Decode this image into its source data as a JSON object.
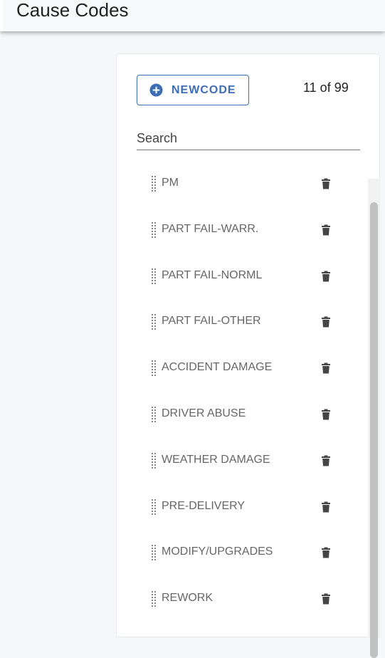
{
  "header": {
    "title": "Cause Codes"
  },
  "toolbar": {
    "new_code_label": "NEWCODE",
    "new_code_icon": "plus-circle-icon",
    "count_text": "11 of 99"
  },
  "search": {
    "placeholder": "Search",
    "value": ""
  },
  "colors": {
    "accent": "#3d6eb5",
    "item_text": "#666666",
    "icon": "#444444",
    "scroll_thumb": "#c1c1c1"
  },
  "list": {
    "items": [
      {
        "label": "PM"
      },
      {
        "label": "PART FAIL-WARR."
      },
      {
        "label": "PART FAIL-NORML"
      },
      {
        "label": "PART FAIL-OTHER"
      },
      {
        "label": "ACCIDENT DAMAGE"
      },
      {
        "label": "DRIVER ABUSE"
      },
      {
        "label": "WEATHER DAMAGE"
      },
      {
        "label": "PRE-DELIVERY"
      },
      {
        "label": "MODIFY/UPGRADES"
      },
      {
        "label": "REWORK"
      }
    ]
  }
}
